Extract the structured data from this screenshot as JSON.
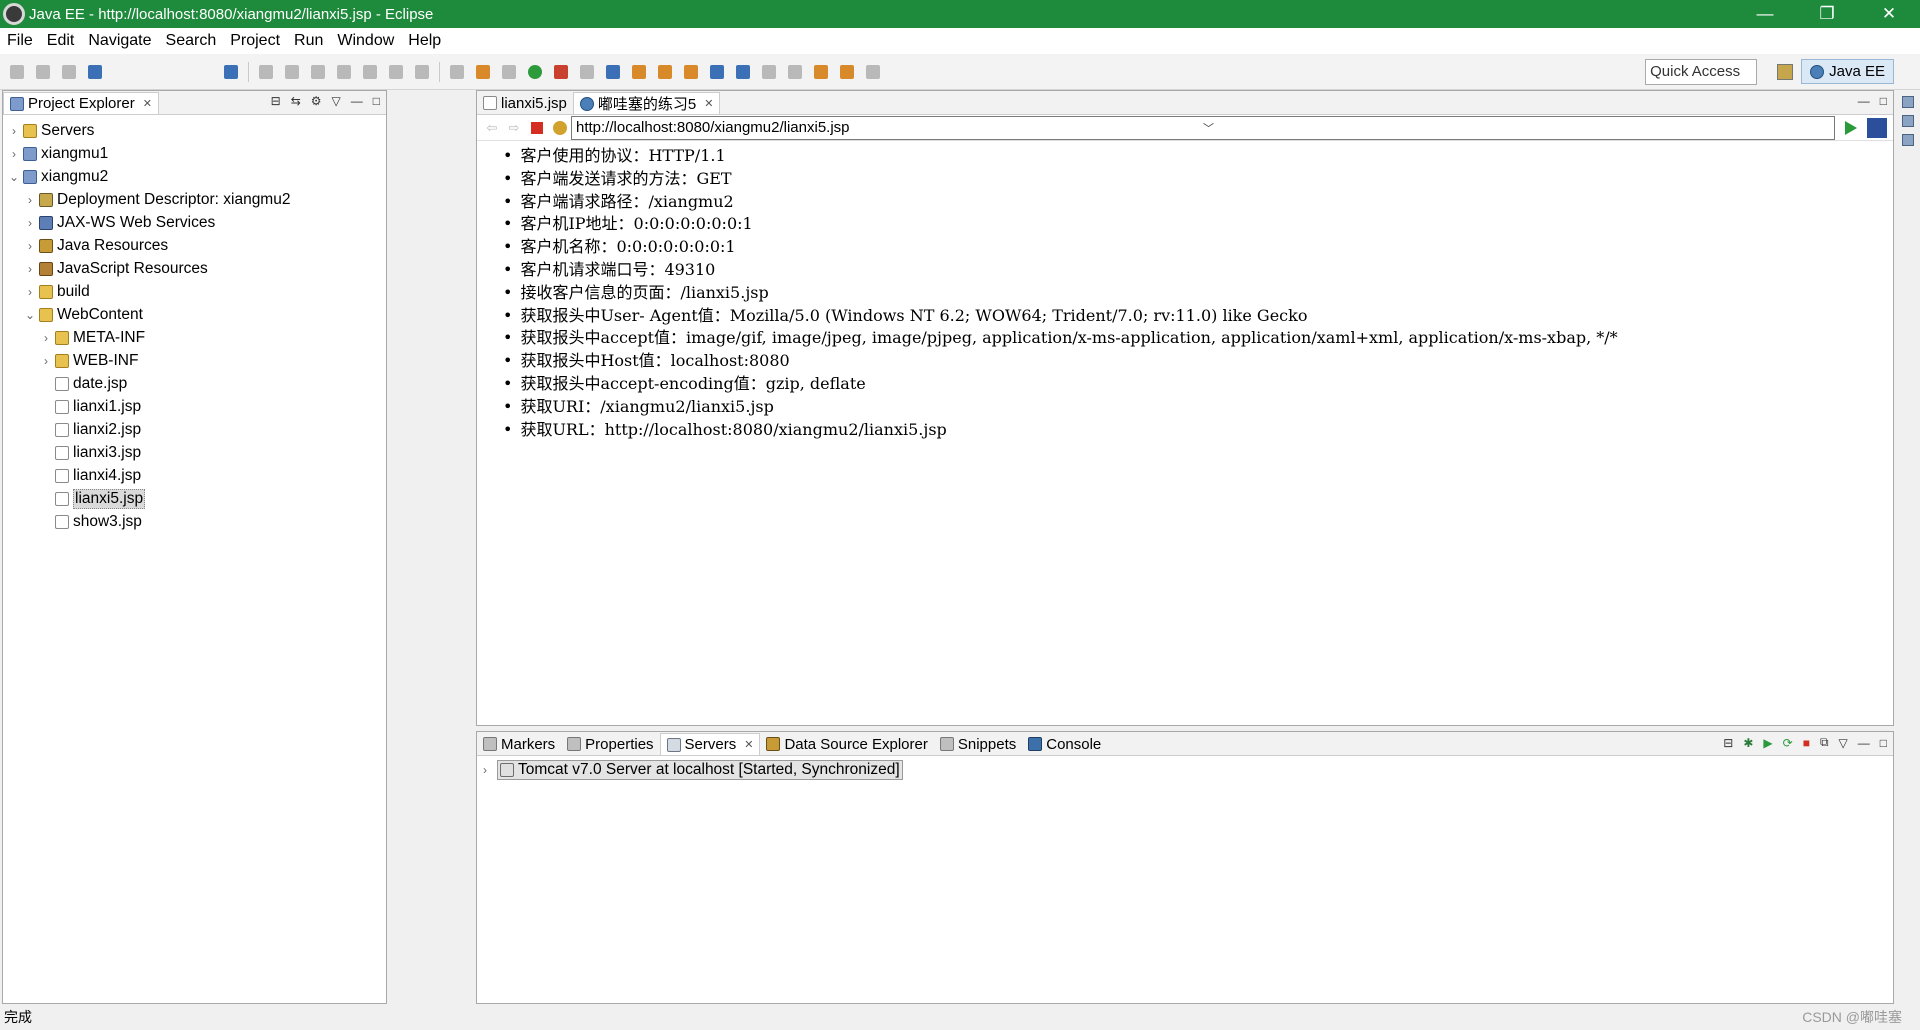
{
  "window": {
    "title": "Java EE - http://localhost:8080/xiangmu2/lianxi5.jsp - Eclipse",
    "min": "—",
    "max": "❐",
    "close": "✕"
  },
  "menu": [
    "File",
    "Edit",
    "Navigate",
    "Search",
    "Project",
    "Run",
    "Window",
    "Help"
  ],
  "toolbar": {
    "quick_access": "Quick Access",
    "perspective": "Java EE"
  },
  "project_explorer": {
    "tab_label": "Project Explorer",
    "tree": [
      {
        "label": "Servers",
        "twisty": "›",
        "icon": "folder-icon"
      },
      {
        "label": "xiangmu1",
        "twisty": "›",
        "icon": "project-icon"
      },
      {
        "label": "xiangmu2",
        "twisty": "⌄",
        "icon": "project-icon"
      },
      {
        "label": "Deployment Descriptor: xiangmu2",
        "twisty": "›",
        "icon": "deployment-descriptor-icon"
      },
      {
        "label": "JAX-WS Web Services",
        "twisty": "›",
        "icon": "web-services-icon"
      },
      {
        "label": "Java Resources",
        "twisty": "›",
        "icon": "java-resources-icon"
      },
      {
        "label": "JavaScript Resources",
        "twisty": "›",
        "icon": "javascript-resources-icon"
      },
      {
        "label": "build",
        "twisty": "›",
        "icon": "folder-icon"
      },
      {
        "label": "WebContent",
        "twisty": "⌄",
        "icon": "folder-icon"
      },
      {
        "label": "META-INF",
        "twisty": "›",
        "icon": "folder-icon"
      },
      {
        "label": "WEB-INF",
        "twisty": "›",
        "icon": "folder-icon"
      },
      {
        "label": "date.jsp",
        "twisty": "",
        "icon": "file-icon"
      },
      {
        "label": "lianxi1.jsp",
        "twisty": "",
        "icon": "file-icon"
      },
      {
        "label": "lianxi2.jsp",
        "twisty": "",
        "icon": "file-icon"
      },
      {
        "label": "lianxi3.jsp",
        "twisty": "",
        "icon": "file-icon"
      },
      {
        "label": "lianxi4.jsp",
        "twisty": "",
        "icon": "file-icon"
      },
      {
        "label": "lianxi5.jsp",
        "twisty": "",
        "icon": "file-icon"
      },
      {
        "label": "show3.jsp",
        "twisty": "",
        "icon": "file-icon"
      }
    ]
  },
  "editor": {
    "tabs": [
      {
        "label": "lianxi5.jsp"
      },
      {
        "label": "嘟哇塞的练习5"
      }
    ],
    "url": "http://localhost:8080/xiangmu2/lianxi5.jsp",
    "content_lines": [
      "客户使用的协议：HTTP/1.1",
      "客户端发送请求的方法：GET",
      "客户端请求路径：/xiangmu2",
      "客户机IP地址：0:0:0:0:0:0:0:1",
      "客户机名称：0:0:0:0:0:0:0:1",
      "客户机请求端口号：49310",
      "接收客户信息的页面：/lianxi5.jsp",
      "获取报头中User- Agent值：Mozilla/5.0 (Windows NT 6.2; WOW64; Trident/7.0; rv:11.0) like Gecko",
      "获取报头中accept值：image/gif, image/jpeg, image/pjpeg, application/x-ms-application, application/xaml+xml, application/x-ms-xbap, */*",
      "获取报头中Host值：localhost:8080",
      "获取报头中accept-encoding值：gzip, deflate",
      "获取URI：/xiangmu2/lianxi5.jsp",
      "获取URL：http://localhost:8080/xiangmu2/lianxi5.jsp"
    ]
  },
  "bottom_panel": {
    "tabs": [
      "Markers",
      "Properties",
      "Servers",
      "Data Source Explorer",
      "Snippets",
      "Console"
    ],
    "server_entry": "Tomcat v7.0 Server at localhost  [Started, Synchronized]"
  },
  "status": {
    "text": "完成",
    "watermark": "CSDN @嘟哇塞"
  }
}
